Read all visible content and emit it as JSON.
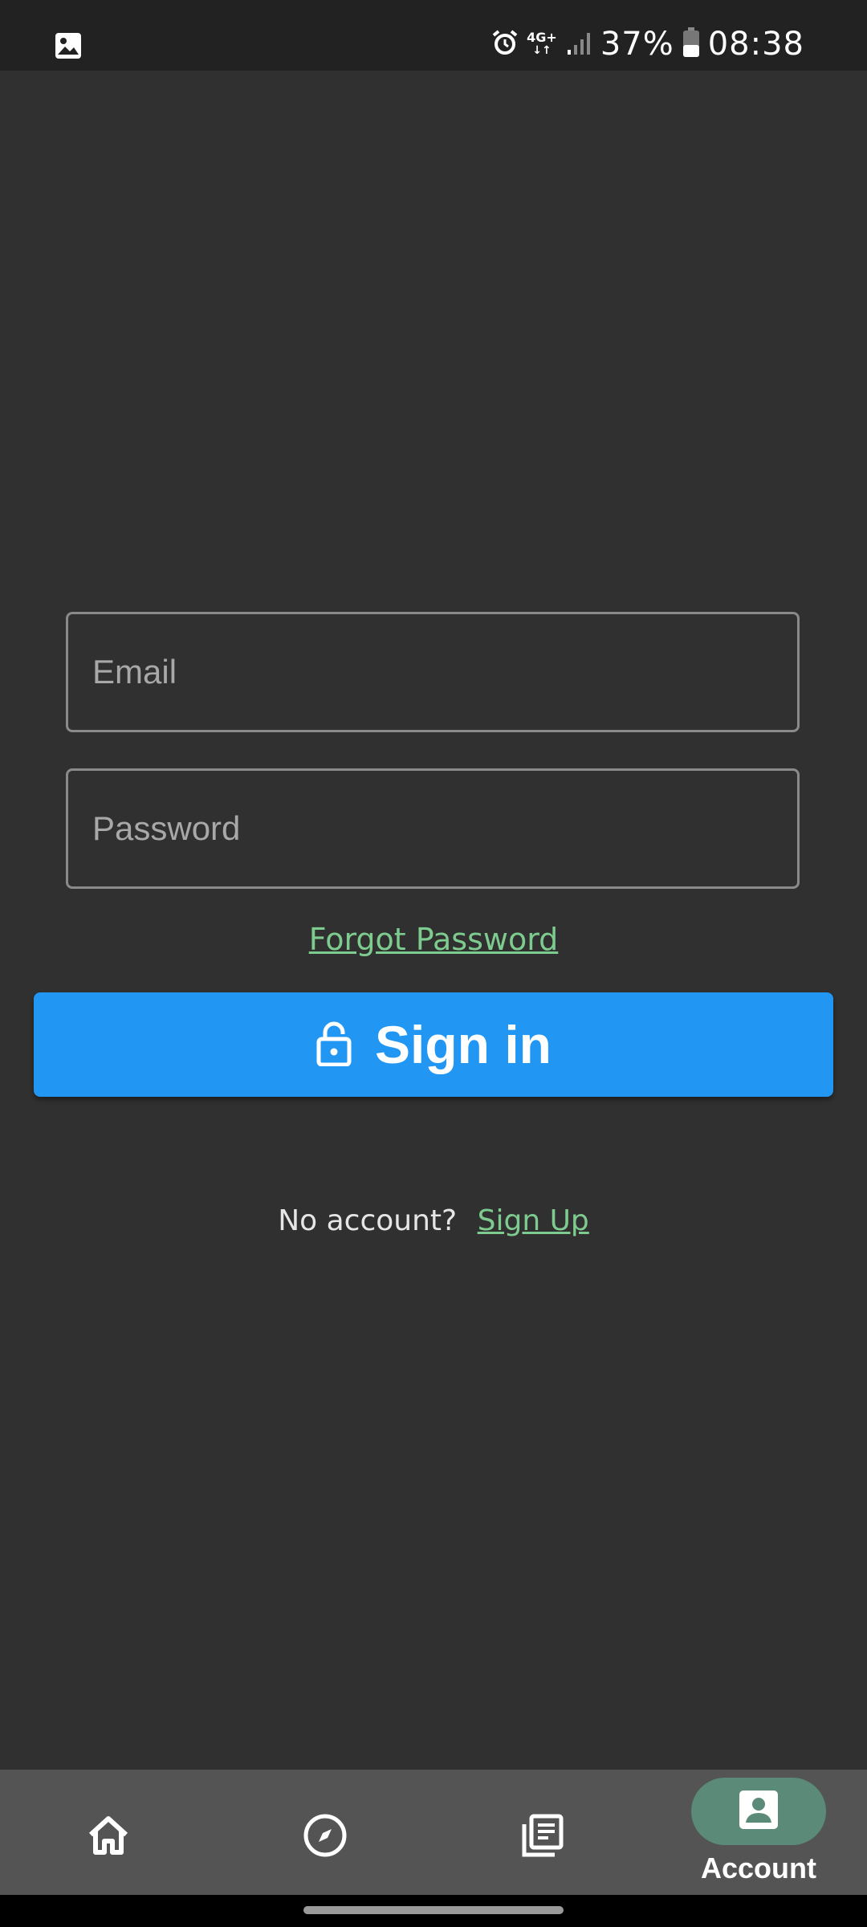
{
  "status_bar": {
    "network": "4G+",
    "battery": "37%",
    "time": "08:38"
  },
  "form": {
    "email_placeholder": "Email",
    "password_placeholder": "Password",
    "forgot_password": "Forgot Password",
    "signin_label": "Sign in"
  },
  "signup": {
    "prompt": "No account?",
    "link": "Sign Up"
  },
  "bottom_nav": {
    "items": [
      {
        "icon": "home-icon",
        "label": ""
      },
      {
        "icon": "compass-icon",
        "label": ""
      },
      {
        "icon": "library-icon",
        "label": ""
      },
      {
        "icon": "account-icon",
        "label": "Account",
        "selected": true
      }
    ]
  },
  "colors": {
    "background": "#303030",
    "primary_button": "#2196f3",
    "link_green": "#7ecb8f",
    "nav_bar": "#545454",
    "selected_pill": "#5b8a78"
  }
}
